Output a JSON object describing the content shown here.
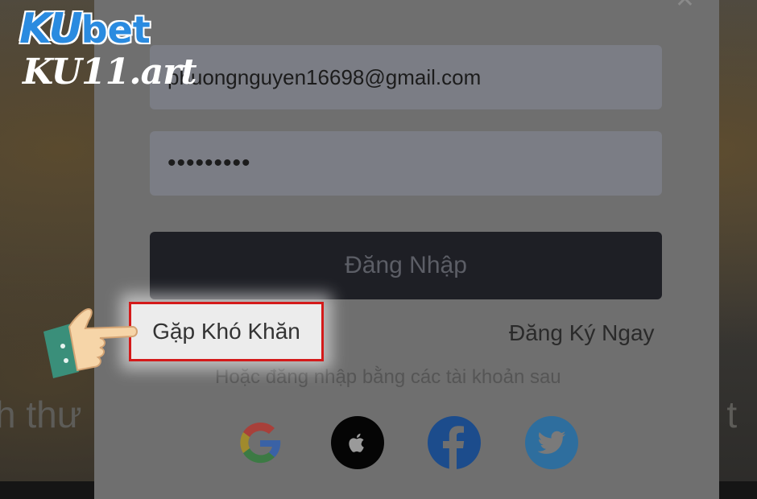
{
  "logo": {
    "brand_ku": "KU",
    "brand_bet": "bet",
    "domain": "KU11.art"
  },
  "background": {
    "text_left": "h thư",
    "text_right": "n t"
  },
  "login_form": {
    "email_value": "phuongnguyen16698@gmail.com",
    "password_value": "•••••••••",
    "login_button": "Đăng Nhập",
    "trouble_link": "Gặp Khó Khăn",
    "register_link": "Đăng Ký Ngay",
    "alt_login_text": "Hoặc đăng nhập bằng các tài khoản sau"
  },
  "social_icons": [
    "google-icon",
    "apple-icon",
    "facebook-icon",
    "twitter-icon"
  ],
  "colors": {
    "highlight_border": "#d41a1a",
    "brand_blue": "#2a8be0"
  }
}
